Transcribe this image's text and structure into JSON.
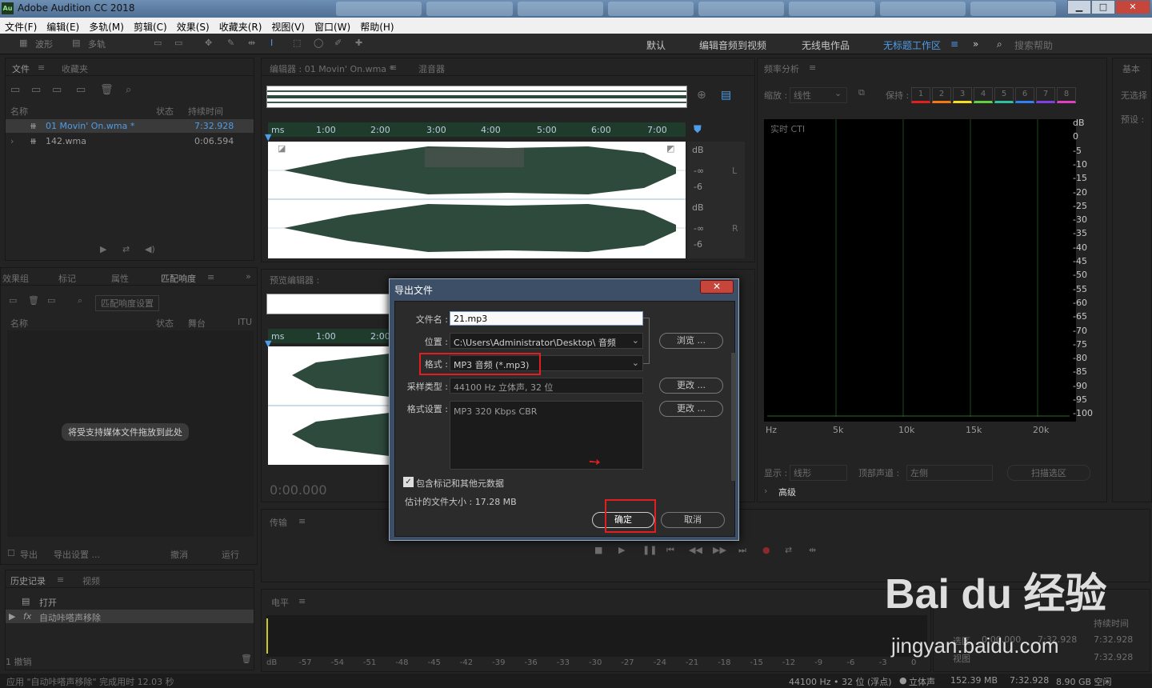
{
  "window": {
    "app_icon_text": "Au",
    "title": "Adobe Audition CC 2018",
    "minimize": "▁",
    "maximize": "□",
    "close": "✕"
  },
  "menu": [
    "文件(F)",
    "编辑(E)",
    "多轨(M)",
    "剪辑(C)",
    "效果(S)",
    "收藏夹(R)",
    "视图(V)",
    "窗口(W)",
    "帮助(H)"
  ],
  "toolbar": {
    "waveform": "波形",
    "multitrack": "多轨"
  },
  "workspaces": [
    "默认",
    "编辑音频到视频",
    "无线电作品",
    "无标题工作区"
  ],
  "search_placeholder": "搜索帮助",
  "files_panel": {
    "tabs": [
      "文件",
      "收藏夹"
    ],
    "columns": [
      "名称",
      "状态",
      "持续时间"
    ],
    "rows": [
      {
        "name": "01 Movin' On.wma *",
        "duration": "7:32.928"
      },
      {
        "name": "142.wma",
        "duration": "0:06.594"
      }
    ]
  },
  "effects_panel": {
    "tabs": [
      "效果组",
      "标记",
      "属性",
      "匹配响度"
    ],
    "match_settings": "匹配响度设置",
    "columns": [
      "名称",
      "状态",
      "舞台",
      "ITU"
    ],
    "drop_hint": "将受支持媒体文件拖放到此处",
    "export_checkbox": "导出",
    "export_settings": "导出设置 ...",
    "undo": "撤消",
    "run": "运行"
  },
  "history_panel": {
    "tabs": [
      "历史记录",
      "视频"
    ],
    "items": [
      "打开",
      "自动咔嗒声移除"
    ],
    "undo_count": "1 撤销"
  },
  "editor": {
    "tab": "编辑器 : 01 Movin' On.wma *",
    "mixer_tab": "混音器",
    "ruler_labels": [
      "ms",
      "1:00",
      "2:00",
      "3:00",
      "4:00",
      "5:00",
      "6:00",
      "7:00"
    ],
    "db_labels": [
      "dB",
      "-∞",
      "-6",
      "dB",
      "-∞",
      "-6"
    ],
    "channel_l": "L",
    "channel_r": "R"
  },
  "preview_editor": {
    "tab": "预览编辑器 :",
    "ruler_labels": [
      "ms",
      "1:00",
      "2:00"
    ],
    "time": "0:00.000"
  },
  "transport": {
    "label": "传输"
  },
  "level": {
    "label": "电平",
    "scale": [
      "dB",
      "-57",
      "-54",
      "-51",
      "-48",
      "-45",
      "-42",
      "-39",
      "-36",
      "-33",
      "-30",
      "-27",
      "-24",
      "-21",
      "-18",
      "-15",
      "-12",
      "-9",
      "-6",
      "-3",
      "0"
    ]
  },
  "selection_panel": {
    "duration_label": "持续时间",
    "rows": [
      "7:32.928",
      "7:32.928",
      "7:32.928"
    ],
    "sel_label": "选区",
    "view_label": "视图",
    "sel_start": "0:00.000"
  },
  "spectrum": {
    "title": "频率分析",
    "scale_label": "缩放 :",
    "scale_value": "线性",
    "hold_label": "保持 :",
    "hold_buttons": [
      "1",
      "2",
      "3",
      "4",
      "5",
      "6",
      "7",
      "8"
    ],
    "hold_colors": [
      "#e02020",
      "#f07a10",
      "#f0e020",
      "#60d040",
      "#30c0a0",
      "#3080f0",
      "#8040e0",
      "#e040c0"
    ],
    "cti_label": "实时 CTI",
    "db_scale": [
      "dB",
      "0",
      "-5",
      "-10",
      "-15",
      "-20",
      "-25",
      "-30",
      "-35",
      "-40",
      "-45",
      "-50",
      "-55",
      "-60",
      "-65",
      "-70",
      "-75",
      "-80",
      "-85",
      "-90",
      "-95",
      "-100"
    ],
    "hz_scale": [
      "Hz",
      "5k",
      "10k",
      "15k",
      "20k"
    ],
    "display_label": "显示 :",
    "display_value": "线形",
    "top_channel_label": "顶部声道 :",
    "top_channel_value": "左侧",
    "scan_button": "扫描选区",
    "advanced": "高级"
  },
  "side_panel": {
    "items": [
      "基本",
      "无选择",
      "预设 :"
    ]
  },
  "dialog": {
    "title": "导出文件",
    "close": "✕",
    "filename_label": "文件名 :",
    "filename_value": "21.mp3",
    "location_label": "位置 :",
    "location_value": "C:\\Users\\Administrator\\Desktop\\ 音频",
    "browse": "浏览 ...",
    "format_label": "格式 :",
    "format_value": "MP3 音频 (*.mp3)",
    "sample_label": "采样类型 :",
    "sample_value": "44100 Hz 立体声, 32 位",
    "change": "更改 ...",
    "format_settings_label": "格式设置 :",
    "format_settings_value": "MP3 320 Kbps CBR",
    "include_markers": "包含标记和其他元数据",
    "include_markers_checked": true,
    "estimated_size": "估计的文件大小 : 17.28 MB",
    "ok": "确定",
    "cancel": "取消"
  },
  "status": {
    "left": "应用 \"自动咔嗒声移除\" 完成用时 12.03 秒",
    "sample_rate": "44100 Hz • 32 位 (浮点)",
    "channels": "立体声",
    "file_size": "152.39 MB",
    "duration": "7:32.928",
    "free_space": "8.90 GB 空闲"
  },
  "watermark": {
    "logo": "Bai du 经验",
    "url": "jingyan.baidu.com"
  }
}
